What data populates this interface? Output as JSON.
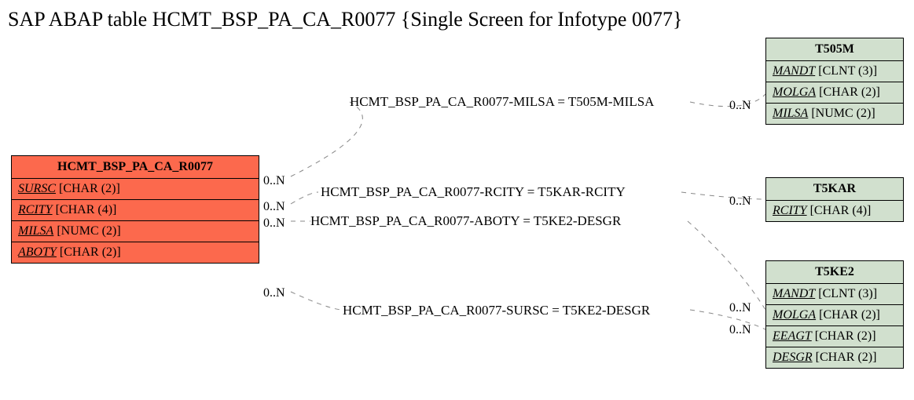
{
  "title": "SAP ABAP table HCMT_BSP_PA_CA_R0077 {Single Screen for Infotype 0077}",
  "left_table": {
    "name": "HCMT_BSP_PA_CA_R0077",
    "fields": [
      {
        "name": "SURSC",
        "type": "[CHAR (2)]"
      },
      {
        "name": "RCITY",
        "type": "[CHAR (4)]"
      },
      {
        "name": "MILSA",
        "type": "[NUMC (2)]"
      },
      {
        "name": "ABOTY",
        "type": "[CHAR (2)]"
      }
    ]
  },
  "right_t505m": {
    "name": "T505M",
    "fields": [
      {
        "name": "MANDT",
        "type": "[CLNT (3)]"
      },
      {
        "name": "MOLGA",
        "type": "[CHAR (2)]"
      },
      {
        "name": "MILSA",
        "type": "[NUMC (2)]"
      }
    ]
  },
  "right_t5kar": {
    "name": "T5KAR",
    "fields": [
      {
        "name": "RCITY",
        "type": "[CHAR (4)]"
      }
    ]
  },
  "right_t5ke2": {
    "name": "T5KE2",
    "fields": [
      {
        "name": "MANDT",
        "type": "[CLNT (3)]"
      },
      {
        "name": "MOLGA",
        "type": "[CHAR (2)]"
      },
      {
        "name": "EEAGT",
        "type": "[CHAR (2)]"
      },
      {
        "name": "DESGR",
        "type": "[CHAR (2)]"
      }
    ]
  },
  "relations": {
    "r1": "HCMT_BSP_PA_CA_R0077-MILSA = T505M-MILSA",
    "r2": "HCMT_BSP_PA_CA_R0077-RCITY = T5KAR-RCITY",
    "r3": "HCMT_BSP_PA_CA_R0077-ABOTY = T5KE2-DESGR",
    "r4": "HCMT_BSP_PA_CA_R0077-SURSC = T5KE2-DESGR"
  },
  "card": {
    "left_r1": "0..N",
    "left_r2": "0..N",
    "left_r3": "0..N",
    "left_r4": "0..N",
    "right_r1": "0..N",
    "right_r2": "0..N",
    "right_r3": "0..N",
    "right_r4": "0..N"
  }
}
